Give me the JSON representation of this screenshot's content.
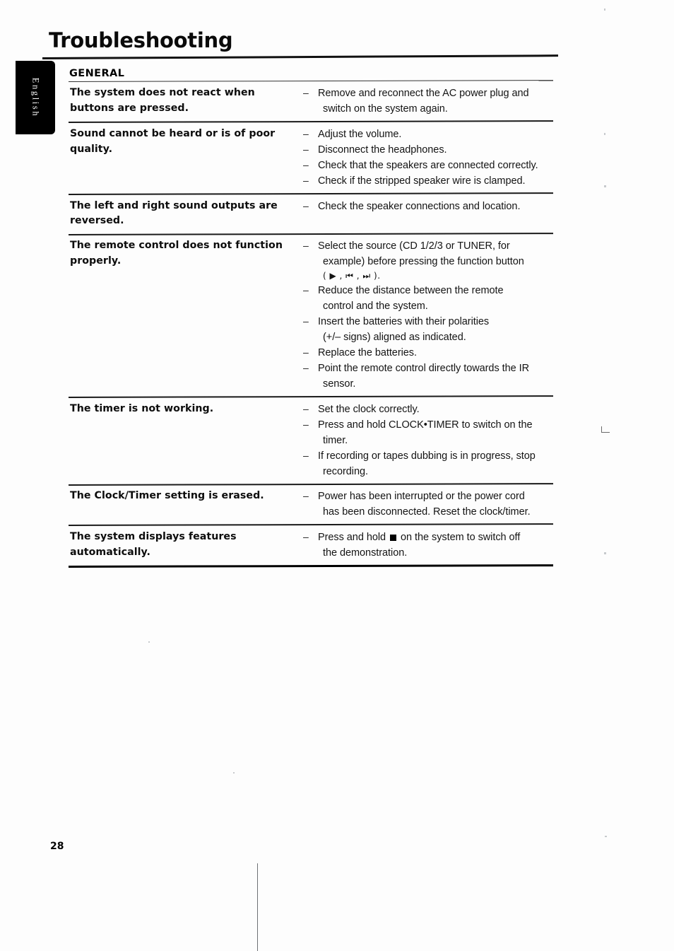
{
  "document": {
    "title": "Troubleshooting",
    "page_number": "28",
    "language_tab": "English"
  },
  "table": {
    "section_heading": "GENERAL",
    "rows": [
      {
        "problem": "The system does not react when buttons are pressed.",
        "solutions": [
          {
            "text": "Remove and reconnect the AC power plug and",
            "continuation": "switch on the system again."
          }
        ]
      },
      {
        "problem": "Sound cannot be heard or is of poor quality.",
        "solutions": [
          {
            "text": "Adjust the volume."
          },
          {
            "text": "Disconnect the headphones."
          },
          {
            "text": "Check that the speakers are connected correctly."
          },
          {
            "text": "Check if the stripped speaker wire is clamped."
          }
        ]
      },
      {
        "problem": "The left and right sound outputs are reversed.",
        "solutions": [
          {
            "text": "Check the speaker connections and location."
          }
        ]
      },
      {
        "problem": "The remote control does not function properly.",
        "solutions": [
          {
            "text": "Select the source (CD 1/2/3 or TUNER, for",
            "continuation": "example) before pressing the function button",
            "continuation2": "( ▶ , ⏮ , ⏭ )."
          },
          {
            "text": "Reduce the distance between the remote",
            "continuation": "control and the system."
          },
          {
            "text": "Insert the batteries with their polarities",
            "continuation": "(+/– signs) aligned as indicated."
          },
          {
            "text": "Replace the batteries."
          },
          {
            "text": "Point the remote control directly towards the IR",
            "continuation": "sensor."
          }
        ]
      },
      {
        "problem": "The timer is not working.",
        "solutions": [
          {
            "text": "Set the clock correctly."
          },
          {
            "text": "Press and hold CLOCK•TIMER to switch on the",
            "continuation": "timer."
          },
          {
            "text": "If recording or tapes dubbing is in progress, stop",
            "continuation": "recording."
          }
        ]
      },
      {
        "problem": "The Clock/Timer setting is erased.",
        "solutions": [
          {
            "text": "Power has been interrupted or the power cord",
            "continuation": "has been disconnected. Reset the clock/timer."
          }
        ]
      },
      {
        "problem": "The system displays features automatically.",
        "solutions": [
          {
            "text_before_glyph": "Press and hold",
            "glyph": "stop-square",
            "text_after_glyph": "on the system to switch off",
            "continuation": "the demonstration."
          }
        ]
      }
    ],
    "dash_marker": "–"
  }
}
